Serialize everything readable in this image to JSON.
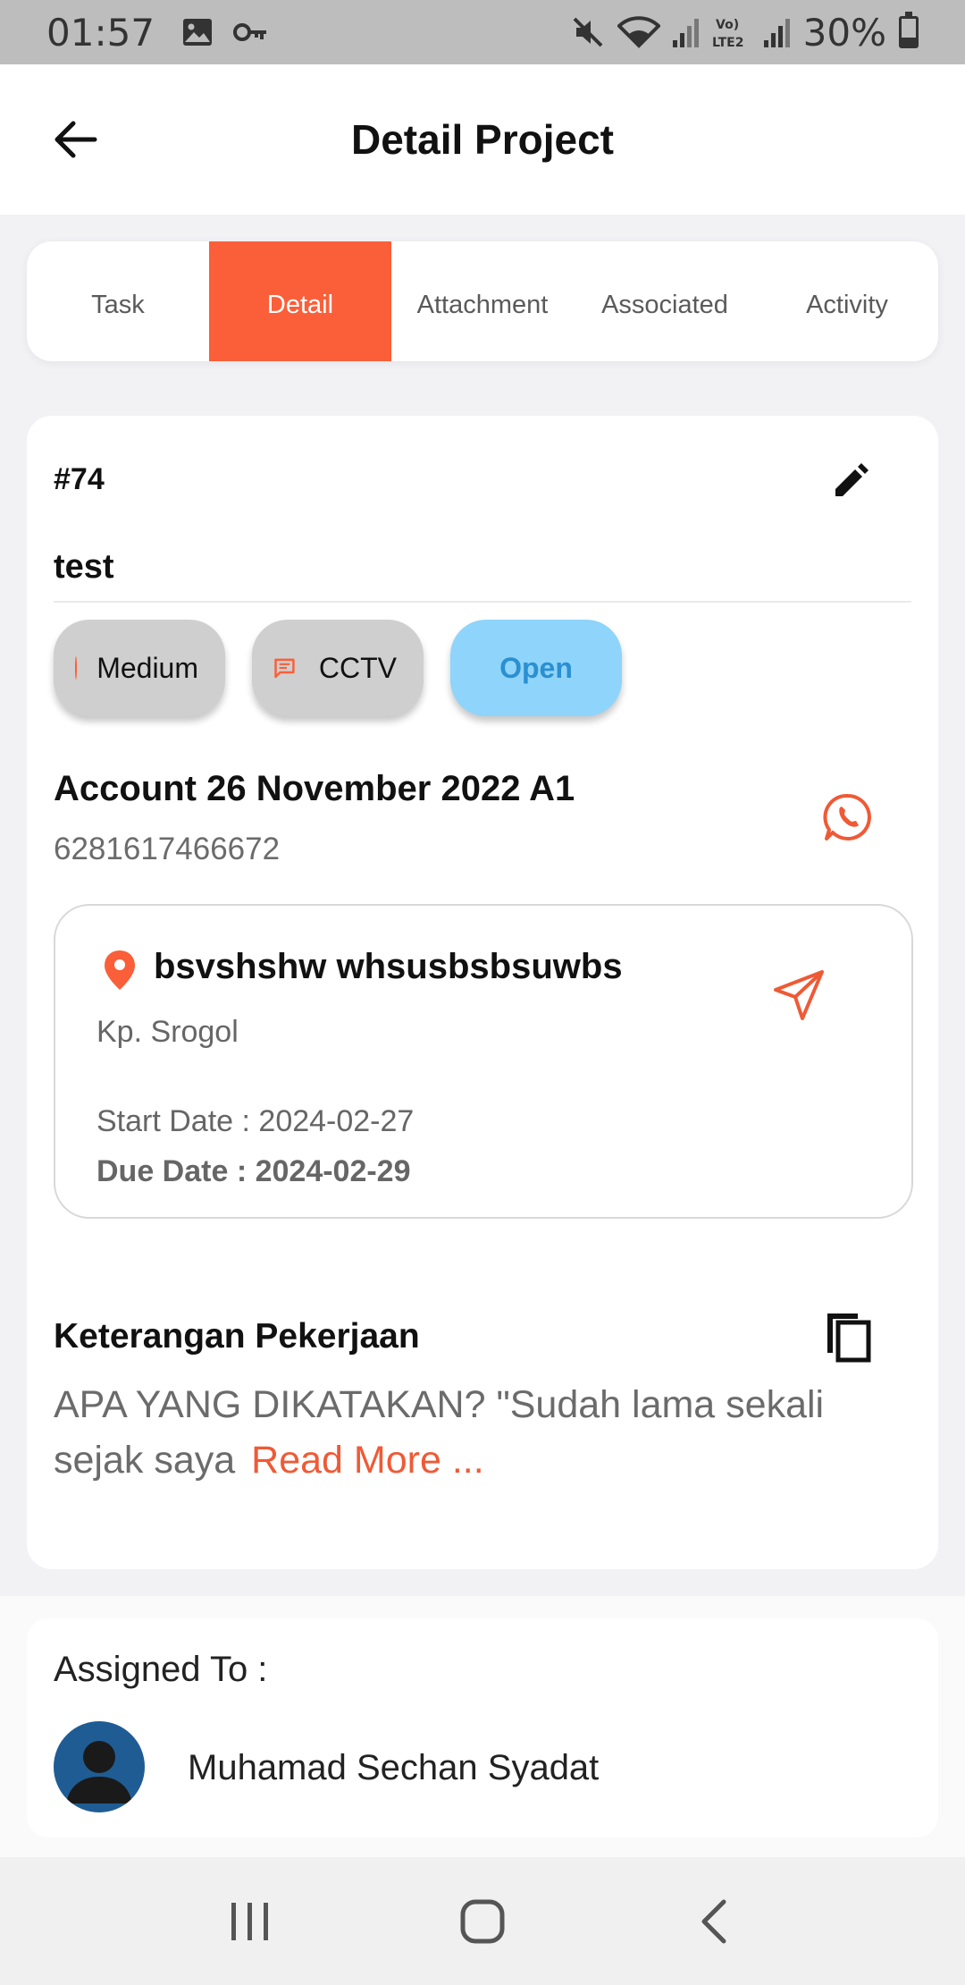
{
  "status_bar": {
    "time": "01:57",
    "battery": "30%",
    "icons": [
      "image-icon",
      "key-icon",
      "mute-icon",
      "wifi-icon",
      "signal-icon",
      "volte-icon",
      "signal-icon",
      "battery-icon"
    ]
  },
  "app_bar": {
    "title": "Detail Project",
    "back_icon": "arrow-left-icon"
  },
  "tabs": [
    {
      "label": "Task",
      "active": false
    },
    {
      "label": "Detail",
      "active": true
    },
    {
      "label": "Attachment",
      "active": false
    },
    {
      "label": "Associated",
      "active": false
    },
    {
      "label": "Activity",
      "active": false
    }
  ],
  "detail": {
    "ticket_id": "#74",
    "title": "test",
    "chips": {
      "priority": "Medium",
      "category": "CCTV",
      "status": "Open"
    },
    "account_name": "Account 26 November 2022 A1",
    "phone": "6281617466672",
    "location": {
      "name": "bsvshshw whsusbsbsuwbs",
      "address": "Kp. Srogol",
      "start_date": "Start Date : 2024-02-27",
      "due_date": "Due Date : 2024-02-29"
    },
    "description_title": "Keterangan Pekerjaan",
    "description": "APA YANG DIKATAKAN? \"Sudah lama sekali sejak saya",
    "read_more": "Read More ..."
  },
  "assigned": {
    "label": "Assigned To :",
    "name": "Muhamad Sechan Syadat"
  },
  "colors": {
    "accent": "#fa5f3a",
    "status_open_bg": "#8fd4fa",
    "status_open_text": "#2b8fd0",
    "chip_bg": "#cfcfcf",
    "avatar_bg": "#1f5c93"
  }
}
